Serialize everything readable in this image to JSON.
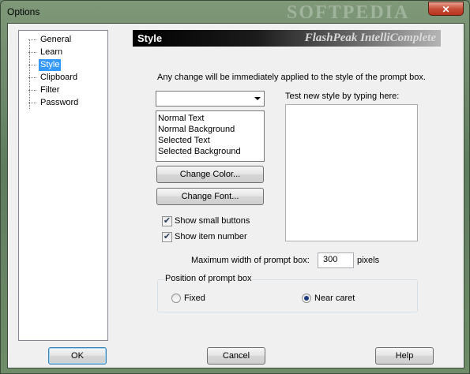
{
  "window": {
    "title": "Options",
    "watermark": "SOFTPEDIA",
    "close_glyph": "✕"
  },
  "tree": {
    "items": [
      {
        "label": "General",
        "selected": false
      },
      {
        "label": "Learn",
        "selected": false
      },
      {
        "label": "Style",
        "selected": true
      },
      {
        "label": "Clipboard",
        "selected": false
      },
      {
        "label": "Filter",
        "selected": false
      },
      {
        "label": "Password",
        "selected": false
      }
    ]
  },
  "header": {
    "title": "Style",
    "product": "FlashPeak IntelliComplete"
  },
  "style_page": {
    "info_text": "Any change will be immediately applied to the style of the prompt box.",
    "dropdown_value": "",
    "list_items": [
      "Normal Text",
      "Normal Background",
      "Selected Text",
      "Selected Background"
    ],
    "change_color_label": "Change Color...",
    "change_font_label": "Change Font...",
    "show_small_buttons_label": "Show small buttons",
    "show_small_buttons_checked": true,
    "show_item_number_label": "Show item number",
    "show_item_number_checked": true,
    "test_label": "Test new style by typing here:",
    "test_value": "",
    "max_width_label": "Maximum width of prompt box:",
    "max_width_value": "300",
    "max_width_unit": "pixels",
    "position_group_label": "Position of prompt box",
    "position_options": [
      {
        "label": "Fixed",
        "selected": false
      },
      {
        "label": "Near caret",
        "selected": true
      }
    ]
  },
  "footer": {
    "ok_label": "OK",
    "cancel_label": "Cancel",
    "help_label": "Help"
  },
  "colors": {
    "selection": "#3399ff",
    "header_dark": "#000000",
    "close_red": "#c8503a"
  }
}
